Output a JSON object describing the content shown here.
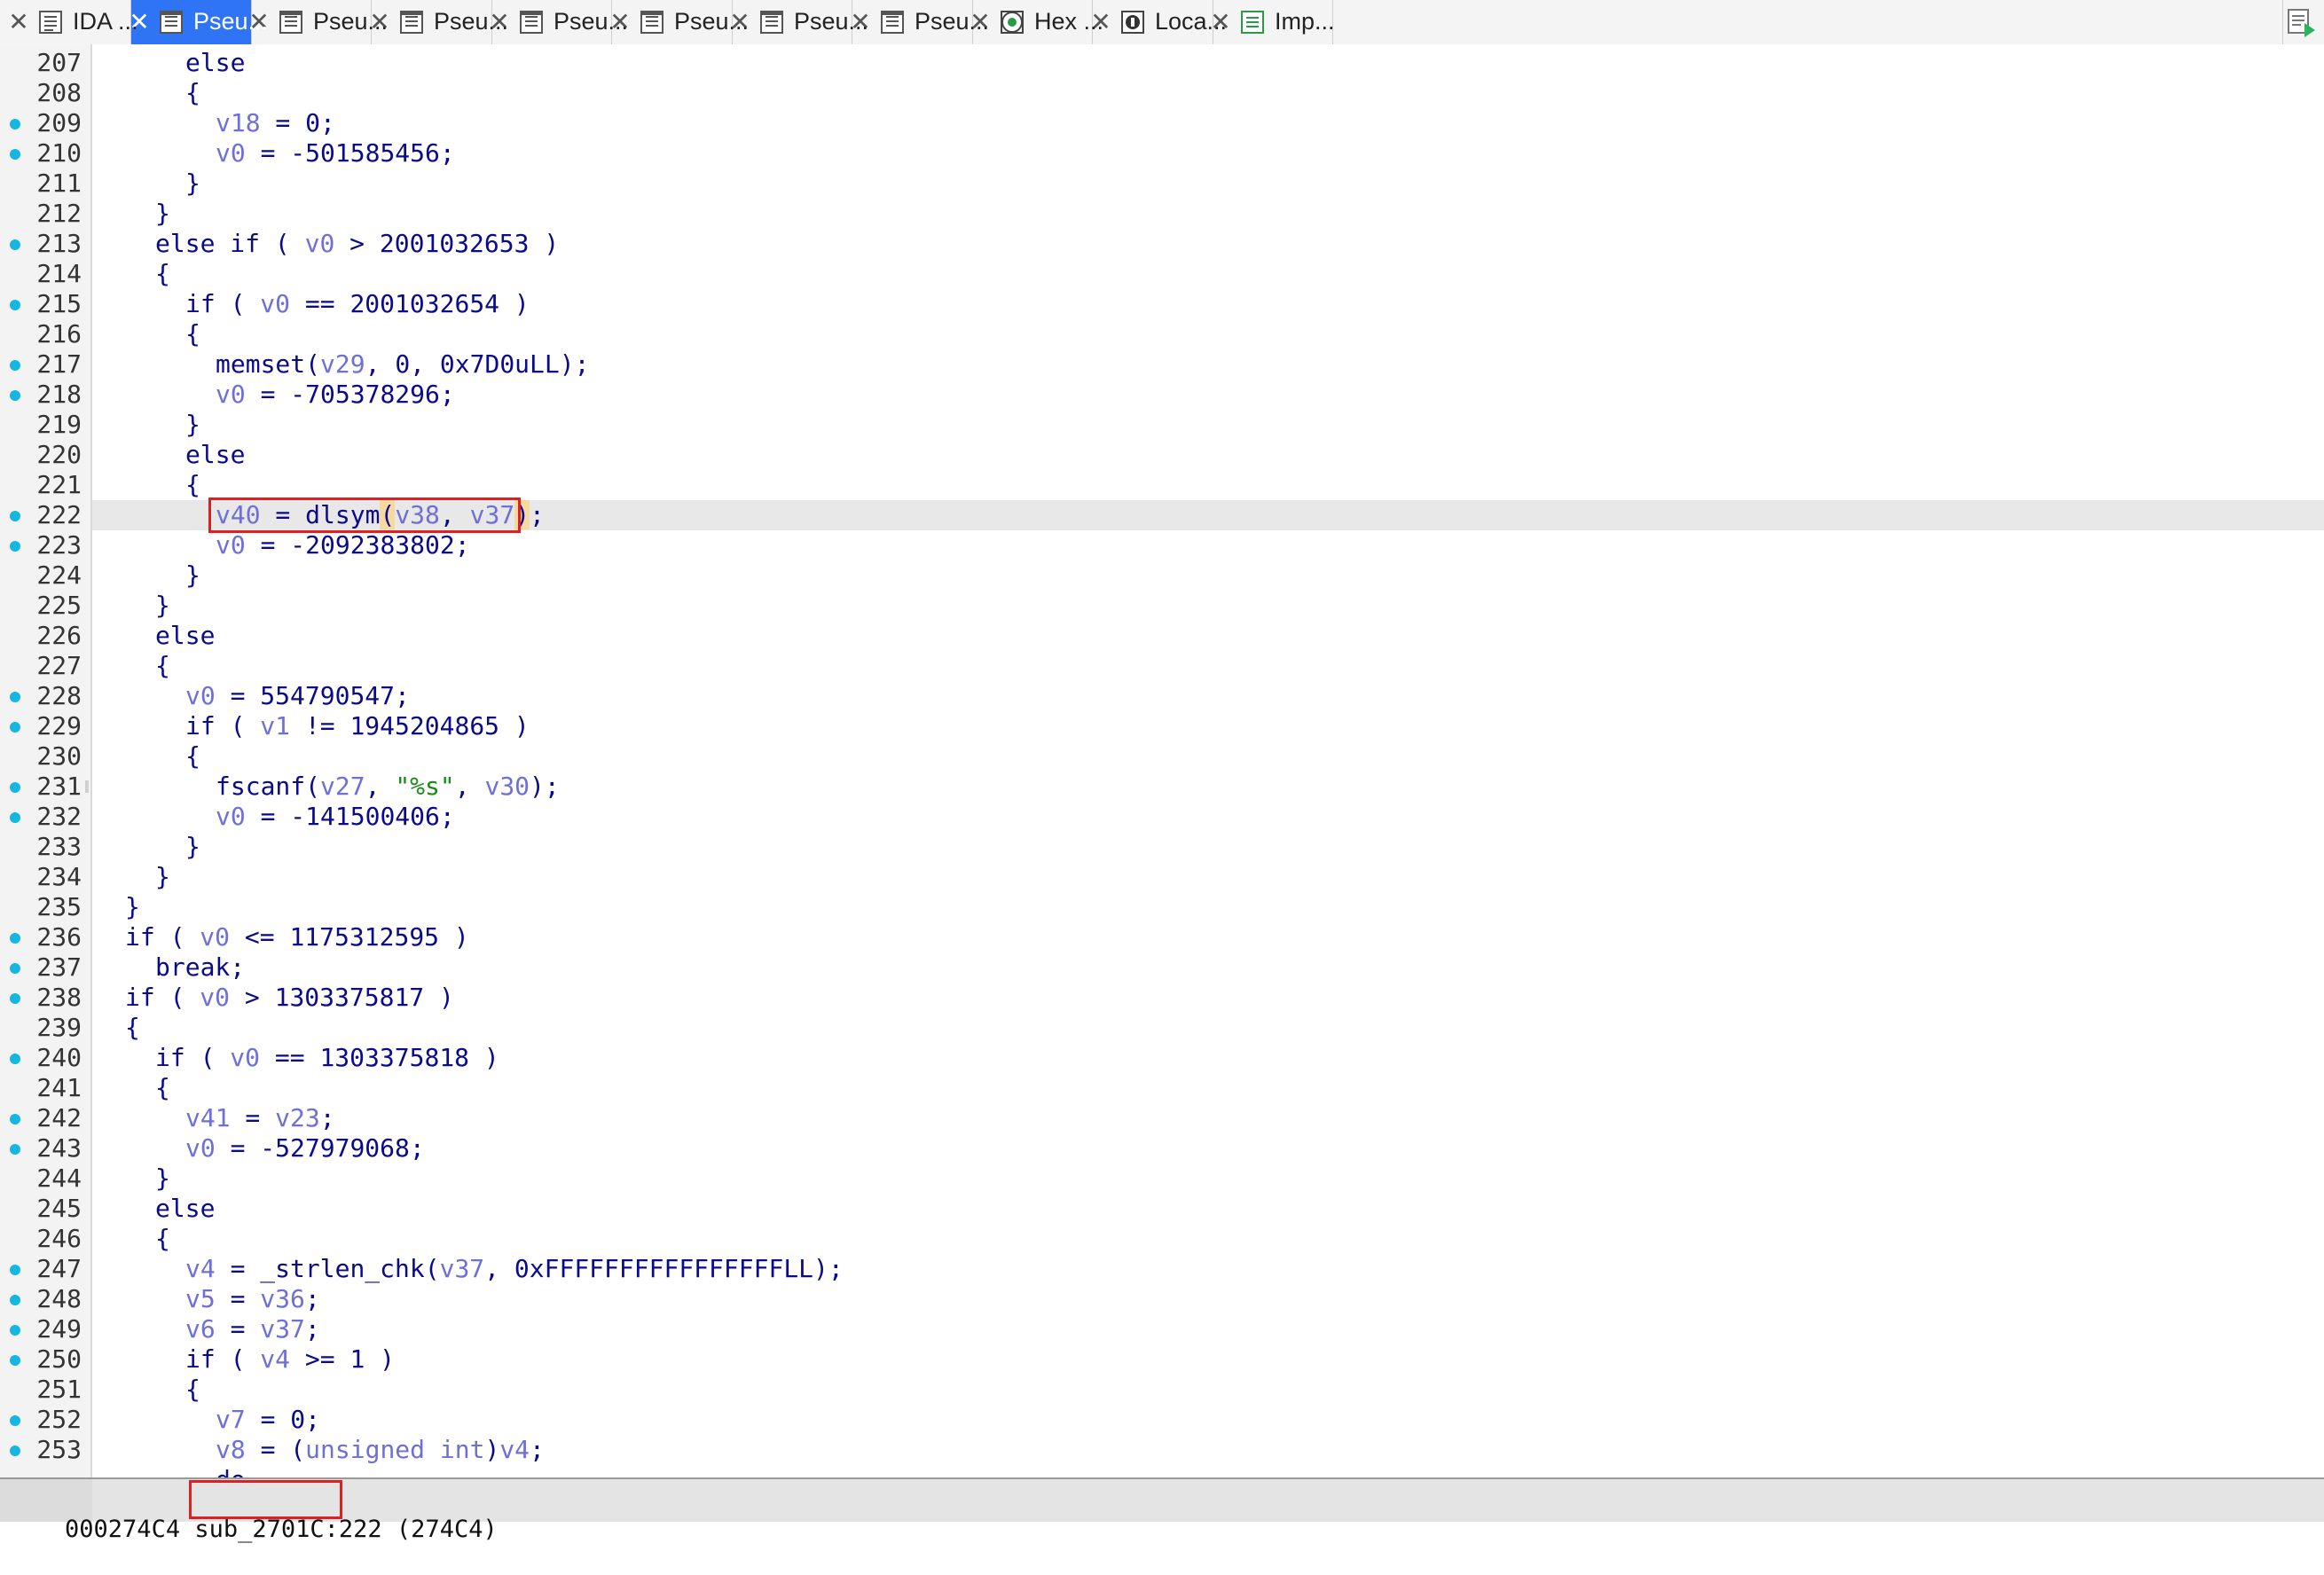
{
  "tabs": [
    {
      "label": "IDA ...",
      "icon": "ida-view-icon",
      "active": false
    },
    {
      "label": "Pseu...",
      "icon": "pseudocode-icon",
      "active": true
    },
    {
      "label": "Pseu...",
      "icon": "pseudocode-icon",
      "active": false
    },
    {
      "label": "Pseu...",
      "icon": "pseudocode-icon",
      "active": false
    },
    {
      "label": "Pseu...",
      "icon": "pseudocode-icon",
      "active": false
    },
    {
      "label": "Pseu...",
      "icon": "pseudocode-icon",
      "active": false
    },
    {
      "label": "Pseu...",
      "icon": "pseudocode-icon",
      "active": false
    },
    {
      "label": "Pseu...",
      "icon": "pseudocode-icon",
      "active": false
    },
    {
      "label": "Hex ...",
      "icon": "hex-view-icon",
      "active": false
    },
    {
      "label": "Loca...",
      "icon": "local-types-icon",
      "active": false
    },
    {
      "label": "Imp...",
      "icon": "imports-icon",
      "active": false
    }
  ],
  "close_glyph": "✕",
  "lines": [
    {
      "n": "207",
      "dot": false,
      "indent": 6,
      "toks": [
        [
          "kw",
          "else"
        ]
      ]
    },
    {
      "n": "208",
      "dot": false,
      "indent": 6,
      "toks": [
        [
          "pun",
          "{"
        ]
      ]
    },
    {
      "n": "209",
      "dot": true,
      "indent": 7,
      "toks": [
        [
          "var",
          "v18"
        ],
        [
          "pun",
          " = "
        ],
        [
          "num",
          "0"
        ],
        [
          "pun",
          ";"
        ]
      ]
    },
    {
      "n": "210",
      "dot": true,
      "indent": 7,
      "toks": [
        [
          "var",
          "v0"
        ],
        [
          "pun",
          " = "
        ],
        [
          "num",
          "-501585456"
        ],
        [
          "pun",
          ";"
        ]
      ]
    },
    {
      "n": "211",
      "dot": false,
      "indent": 6,
      "toks": [
        [
          "pun",
          "}"
        ]
      ]
    },
    {
      "n": "212",
      "dot": false,
      "indent": 5,
      "toks": [
        [
          "pun",
          "}"
        ]
      ]
    },
    {
      "n": "213",
      "dot": true,
      "indent": 5,
      "toks": [
        [
          "kw",
          "else if"
        ],
        [
          "pun",
          " ( "
        ],
        [
          "var",
          "v0"
        ],
        [
          "pun",
          " > "
        ],
        [
          "num",
          "2001032653"
        ],
        [
          "pun",
          " )"
        ]
      ]
    },
    {
      "n": "214",
      "dot": false,
      "indent": 5,
      "toks": [
        [
          "pun",
          "{"
        ]
      ]
    },
    {
      "n": "215",
      "dot": true,
      "indent": 6,
      "toks": [
        [
          "kw",
          "if"
        ],
        [
          "pun",
          " ( "
        ],
        [
          "var",
          "v0"
        ],
        [
          "pun",
          " == "
        ],
        [
          "num",
          "2001032654"
        ],
        [
          "pun",
          " )"
        ]
      ]
    },
    {
      "n": "216",
      "dot": false,
      "indent": 6,
      "toks": [
        [
          "pun",
          "{"
        ]
      ]
    },
    {
      "n": "217",
      "dot": true,
      "indent": 7,
      "toks": [
        [
          "fn",
          "memset"
        ],
        [
          "pun",
          "("
        ],
        [
          "var",
          "v29"
        ],
        [
          "pun",
          ", "
        ],
        [
          "num",
          "0"
        ],
        [
          "pun",
          ", "
        ],
        [
          "num",
          "0x7D0uLL"
        ],
        [
          "pun",
          ");"
        ]
      ]
    },
    {
      "n": "218",
      "dot": true,
      "indent": 7,
      "toks": [
        [
          "var",
          "v0"
        ],
        [
          "pun",
          " = "
        ],
        [
          "num",
          "-705378296"
        ],
        [
          "pun",
          ";"
        ]
      ]
    },
    {
      "n": "219",
      "dot": false,
      "indent": 6,
      "toks": [
        [
          "pun",
          "}"
        ]
      ]
    },
    {
      "n": "220",
      "dot": false,
      "indent": 6,
      "toks": [
        [
          "kw",
          "else"
        ]
      ]
    },
    {
      "n": "221",
      "dot": false,
      "indent": 6,
      "toks": [
        [
          "pun",
          "{"
        ]
      ]
    },
    {
      "n": "222",
      "dot": true,
      "indent": 7,
      "toks": [
        [
          "var",
          "v40"
        ],
        [
          "pun",
          " = "
        ],
        [
          "fn",
          "dlsym"
        ],
        [
          "hlp",
          "("
        ],
        [
          "var",
          "v38"
        ],
        [
          "pun",
          ", "
        ],
        [
          "var",
          "v37"
        ],
        [
          "hlp",
          ")"
        ],
        [
          "pun",
          ";"
        ]
      ],
      "current": true
    },
    {
      "n": "223",
      "dot": true,
      "indent": 7,
      "toks": [
        [
          "var",
          "v0"
        ],
        [
          "pun",
          " = "
        ],
        [
          "num",
          "-2092383802"
        ],
        [
          "pun",
          ";"
        ]
      ]
    },
    {
      "n": "224",
      "dot": false,
      "indent": 6,
      "toks": [
        [
          "pun",
          "}"
        ]
      ]
    },
    {
      "n": "225",
      "dot": false,
      "indent": 5,
      "toks": [
        [
          "pun",
          "}"
        ]
      ]
    },
    {
      "n": "226",
      "dot": false,
      "indent": 5,
      "toks": [
        [
          "kw",
          "else"
        ]
      ]
    },
    {
      "n": "227",
      "dot": false,
      "indent": 5,
      "toks": [
        [
          "pun",
          "{"
        ]
      ]
    },
    {
      "n": "228",
      "dot": true,
      "indent": 6,
      "toks": [
        [
          "var",
          "v0"
        ],
        [
          "pun",
          " = "
        ],
        [
          "num",
          "554790547"
        ],
        [
          "pun",
          ";"
        ]
      ]
    },
    {
      "n": "229",
      "dot": true,
      "indent": 6,
      "toks": [
        [
          "kw",
          "if"
        ],
        [
          "pun",
          " ( "
        ],
        [
          "var",
          "v1"
        ],
        [
          "pun",
          " != "
        ],
        [
          "num",
          "1945204865"
        ],
        [
          "pun",
          " )"
        ]
      ]
    },
    {
      "n": "230",
      "dot": false,
      "indent": 6,
      "toks": [
        [
          "pun",
          "{"
        ]
      ]
    },
    {
      "n": "231",
      "dot": true,
      "indent": 7,
      "toks": [
        [
          "fn",
          "fscanf"
        ],
        [
          "pun",
          "("
        ],
        [
          "var",
          "v27"
        ],
        [
          "pun",
          ", "
        ],
        [
          "str",
          "\"%s\""
        ],
        [
          "pun",
          ", "
        ],
        [
          "var",
          "v30"
        ],
        [
          "pun",
          ");"
        ]
      ]
    },
    {
      "n": "232",
      "dot": true,
      "indent": 7,
      "toks": [
        [
          "var",
          "v0"
        ],
        [
          "pun",
          " = "
        ],
        [
          "num",
          "-141500406"
        ],
        [
          "pun",
          ";"
        ]
      ]
    },
    {
      "n": "233",
      "dot": false,
      "indent": 6,
      "toks": [
        [
          "pun",
          "}"
        ]
      ]
    },
    {
      "n": "234",
      "dot": false,
      "indent": 5,
      "toks": [
        [
          "pun",
          "}"
        ]
      ]
    },
    {
      "n": "235",
      "dot": false,
      "indent": 4,
      "toks": [
        [
          "pun",
          "}"
        ]
      ]
    },
    {
      "n": "236",
      "dot": true,
      "indent": 4,
      "toks": [
        [
          "kw",
          "if"
        ],
        [
          "pun",
          " ( "
        ],
        [
          "var",
          "v0"
        ],
        [
          "pun",
          " <= "
        ],
        [
          "num",
          "1175312595"
        ],
        [
          "pun",
          " )"
        ]
      ]
    },
    {
      "n": "237",
      "dot": true,
      "indent": 5,
      "toks": [
        [
          "kw",
          "break"
        ],
        [
          "pun",
          ";"
        ]
      ]
    },
    {
      "n": "238",
      "dot": true,
      "indent": 4,
      "toks": [
        [
          "kw",
          "if"
        ],
        [
          "pun",
          " ( "
        ],
        [
          "var",
          "v0"
        ],
        [
          "pun",
          " > "
        ],
        [
          "num",
          "1303375817"
        ],
        [
          "pun",
          " )"
        ]
      ]
    },
    {
      "n": "239",
      "dot": false,
      "indent": 4,
      "toks": [
        [
          "pun",
          "{"
        ]
      ]
    },
    {
      "n": "240",
      "dot": true,
      "indent": 5,
      "toks": [
        [
          "kw",
          "if"
        ],
        [
          "pun",
          " ( "
        ],
        [
          "var",
          "v0"
        ],
        [
          "pun",
          " == "
        ],
        [
          "num",
          "1303375818"
        ],
        [
          "pun",
          " )"
        ]
      ]
    },
    {
      "n": "241",
      "dot": false,
      "indent": 5,
      "toks": [
        [
          "pun",
          "{"
        ]
      ]
    },
    {
      "n": "242",
      "dot": true,
      "indent": 6,
      "toks": [
        [
          "var",
          "v41"
        ],
        [
          "pun",
          " = "
        ],
        [
          "var",
          "v23"
        ],
        [
          "pun",
          ";"
        ]
      ]
    },
    {
      "n": "243",
      "dot": true,
      "indent": 6,
      "toks": [
        [
          "var",
          "v0"
        ],
        [
          "pun",
          " = "
        ],
        [
          "num",
          "-527979068"
        ],
        [
          "pun",
          ";"
        ]
      ]
    },
    {
      "n": "244",
      "dot": false,
      "indent": 5,
      "toks": [
        [
          "pun",
          "}"
        ]
      ]
    },
    {
      "n": "245",
      "dot": false,
      "indent": 5,
      "toks": [
        [
          "kw",
          "else"
        ]
      ]
    },
    {
      "n": "246",
      "dot": false,
      "indent": 5,
      "toks": [
        [
          "pun",
          "{"
        ]
      ]
    },
    {
      "n": "247",
      "dot": true,
      "indent": 6,
      "toks": [
        [
          "var",
          "v4"
        ],
        [
          "pun",
          " = "
        ],
        [
          "fn",
          "_strlen_chk"
        ],
        [
          "pun",
          "("
        ],
        [
          "var",
          "v37"
        ],
        [
          "pun",
          ", "
        ],
        [
          "num",
          "0xFFFFFFFFFFFFFFFFLL"
        ],
        [
          "pun",
          ");"
        ]
      ]
    },
    {
      "n": "248",
      "dot": true,
      "indent": 6,
      "toks": [
        [
          "var",
          "v5"
        ],
        [
          "pun",
          " = "
        ],
        [
          "var",
          "v36"
        ],
        [
          "pun",
          ";"
        ]
      ]
    },
    {
      "n": "249",
      "dot": true,
      "indent": 6,
      "toks": [
        [
          "var",
          "v6"
        ],
        [
          "pun",
          " = "
        ],
        [
          "var",
          "v37"
        ],
        [
          "pun",
          ";"
        ]
      ]
    },
    {
      "n": "250",
      "dot": true,
      "indent": 6,
      "toks": [
        [
          "kw",
          "if"
        ],
        [
          "pun",
          " ( "
        ],
        [
          "var",
          "v4"
        ],
        [
          "pun",
          " >= "
        ],
        [
          "num",
          "1"
        ],
        [
          "pun",
          " )"
        ]
      ]
    },
    {
      "n": "251",
      "dot": false,
      "indent": 6,
      "toks": [
        [
          "pun",
          "{"
        ]
      ]
    },
    {
      "n": "252",
      "dot": true,
      "indent": 7,
      "toks": [
        [
          "var",
          "v7"
        ],
        [
          "pun",
          " = "
        ],
        [
          "num",
          "0"
        ],
        [
          "pun",
          ";"
        ]
      ]
    },
    {
      "n": "253",
      "dot": true,
      "indent": 7,
      "toks": [
        [
          "var",
          "v8"
        ],
        [
          "pun",
          " = ("
        ],
        [
          "typ",
          "unsigned int"
        ],
        [
          "pun",
          ")"
        ],
        [
          "var",
          "v4"
        ],
        [
          "pun",
          ";"
        ]
      ]
    },
    {
      "n": "",
      "dot": false,
      "indent": 7,
      "toks": [
        [
          "kw",
          "do"
        ]
      ]
    }
  ],
  "status": {
    "address": "000274C4",
    "function": "sub_2701C:",
    "position": "222 (274C4)"
  },
  "colors": {
    "tab_active": "#2f74f5",
    "breakpoint_dot": "#16b6e3",
    "keyword": "#0a0a8a",
    "variable": "#6f6fd6",
    "string": "#1a8a1a",
    "annotation_box": "#e02020"
  }
}
